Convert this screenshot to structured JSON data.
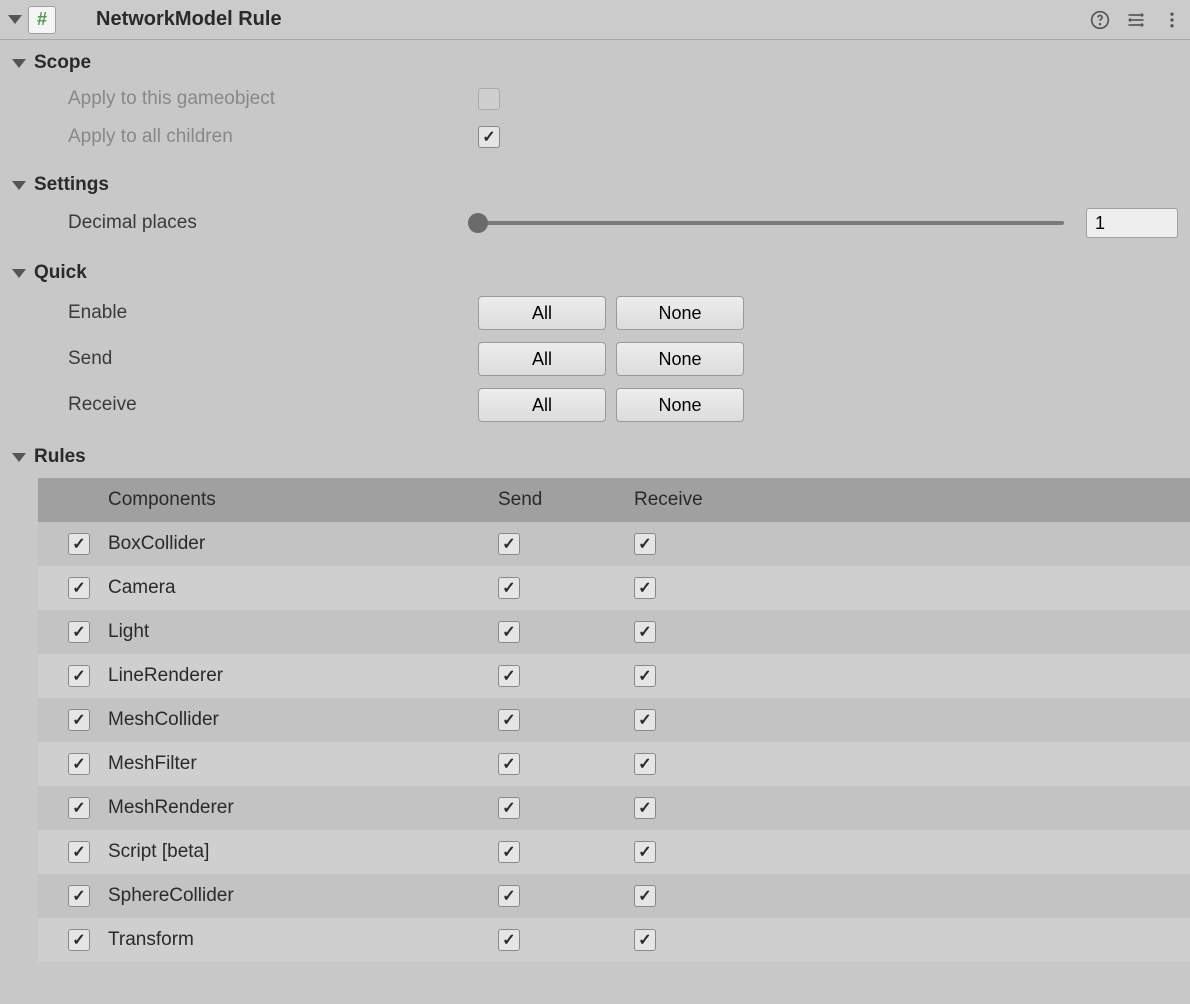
{
  "header": {
    "title": "NetworkModel Rule",
    "scriptGlyph": "#"
  },
  "scope": {
    "title": "Scope",
    "applyThis": {
      "label": "Apply to this gameobject",
      "checked": false,
      "disabled": true
    },
    "applyChildren": {
      "label": "Apply to all children",
      "checked": true
    }
  },
  "settings": {
    "title": "Settings",
    "decimalPlaces": {
      "label": "Decimal places",
      "value": "1"
    }
  },
  "quick": {
    "title": "Quick",
    "allLabel": "All",
    "noneLabel": "None",
    "rows": [
      {
        "label": "Enable"
      },
      {
        "label": "Send"
      },
      {
        "label": "Receive"
      }
    ]
  },
  "rules": {
    "title": "Rules",
    "headers": {
      "components": "Components",
      "send": "Send",
      "receive": "Receive"
    },
    "items": [
      {
        "name": "BoxCollider",
        "enabled": true,
        "send": true,
        "receive": true
      },
      {
        "name": "Camera",
        "enabled": true,
        "send": true,
        "receive": true
      },
      {
        "name": "Light",
        "enabled": true,
        "send": true,
        "receive": true
      },
      {
        "name": "LineRenderer",
        "enabled": true,
        "send": true,
        "receive": true
      },
      {
        "name": "MeshCollider",
        "enabled": true,
        "send": true,
        "receive": true
      },
      {
        "name": "MeshFilter",
        "enabled": true,
        "send": true,
        "receive": true
      },
      {
        "name": "MeshRenderer",
        "enabled": true,
        "send": true,
        "receive": true
      },
      {
        "name": "Script [beta]",
        "enabled": true,
        "send": true,
        "receive": true
      },
      {
        "name": "SphereCollider",
        "enabled": true,
        "send": true,
        "receive": true
      },
      {
        "name": "Transform",
        "enabled": true,
        "send": true,
        "receive": true
      }
    ]
  }
}
